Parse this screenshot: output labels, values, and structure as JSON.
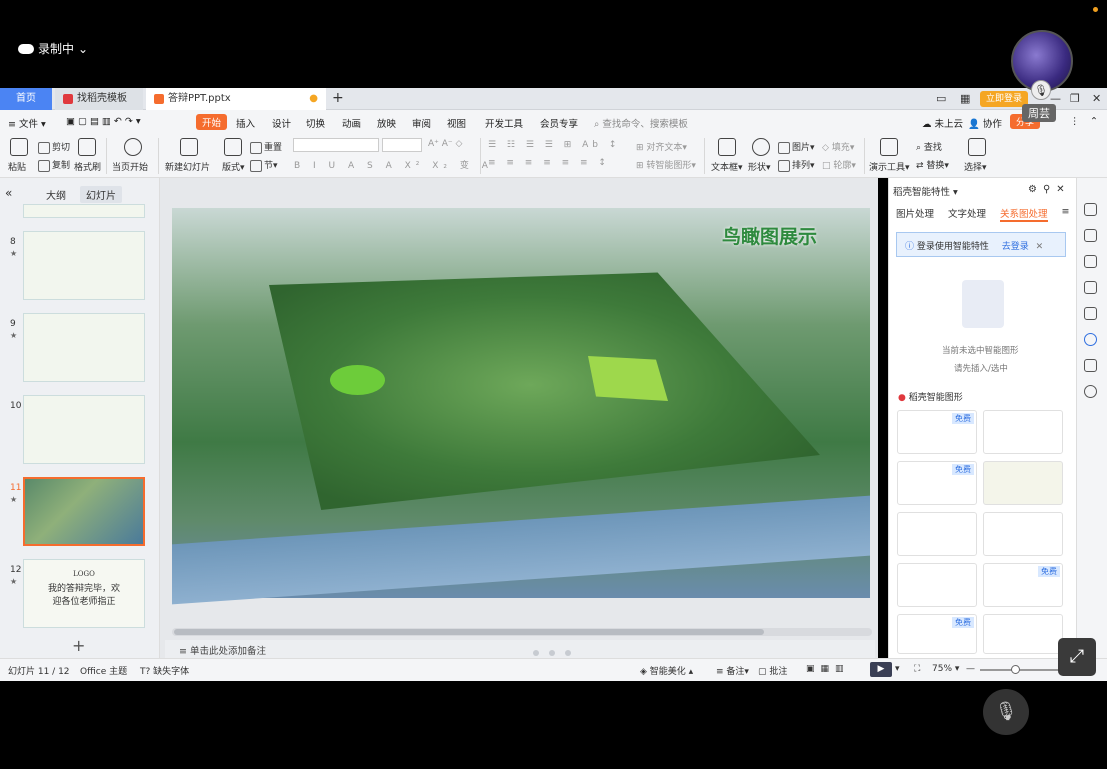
{
  "recording": {
    "label": "录制中"
  },
  "user": {
    "name": "周芸",
    "mic_icon": "mic-icon"
  },
  "tabs": [
    {
      "label": "首页"
    },
    {
      "label": "找稻壳模板"
    },
    {
      "label": "答辩PPT.pptx"
    }
  ],
  "titlebar": {
    "login_label": "立即登录"
  },
  "menu": {
    "file": "文件",
    "items": [
      "开始",
      "插入",
      "设计",
      "切换",
      "动画",
      "放映",
      "审阅",
      "视图",
      "开发工具",
      "会员专享"
    ],
    "search_placeholder": "查找命令、搜索模板",
    "cloud": "未上云",
    "collab": "协作",
    "share": "分享"
  },
  "ribbon": {
    "paste": "粘贴",
    "cut": "剪切",
    "copy": "复制",
    "format_painter": "格式刷",
    "from_current": "当页开始",
    "new_slide": "新建幻灯片",
    "layout": "版式",
    "section": "节",
    "reset": "重置",
    "align_text": "对齐文本",
    "convert_smart": "转智能图形",
    "textbox": "文本框",
    "shape": "形状",
    "picture": "图片",
    "arrange": "排列",
    "fill": "填充",
    "outline": "轮廓",
    "presenter_tools": "演示工具",
    "find": "查找",
    "replace": "替换",
    "select": "选择"
  },
  "left_panel": {
    "tab_outline": "大纲",
    "tab_slides": "幻灯片",
    "slides": [
      {
        "num": "8"
      },
      {
        "num": "9"
      },
      {
        "num": "10"
      },
      {
        "num": "11"
      },
      {
        "num": "12",
        "logo": "LOGO",
        "line1": "我的答辩完毕，欢",
        "line2": "迎各位老师指正"
      }
    ]
  },
  "slide": {
    "title": "鸟瞰图展示"
  },
  "notes": {
    "placeholder": "单击此处添加备注"
  },
  "right_pane": {
    "title": "稻壳智能特性",
    "tabs": [
      "图片处理",
      "文字处理",
      "关系图处理"
    ],
    "login_banner": "登录使用智能特性",
    "login_link": "去登录",
    "empty_line1": "当前未选中智能图形",
    "empty_line2": "请先插入/选中",
    "smart_label": "稻壳智能图形",
    "free_badge": "免费"
  },
  "status": {
    "slide_count": "幻灯片 11 / 12",
    "theme": "Office 主题",
    "missing_font": "缺失字体",
    "beautify": "智能美化",
    "notes": "备注",
    "comments": "批注",
    "zoom": "75%"
  }
}
